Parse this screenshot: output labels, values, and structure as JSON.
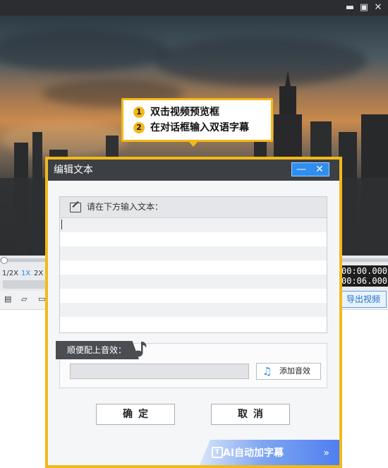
{
  "window": {
    "controls": {
      "minimize": "▬",
      "maximize": "▣",
      "close": "✕"
    }
  },
  "tooltip": {
    "steps": [
      {
        "num": "1",
        "text": "双击视频预览框"
      },
      {
        "num": "2",
        "text": "在对话框输入双语字幕"
      }
    ]
  },
  "player": {
    "speeds": [
      "1/2X",
      "1X",
      "2X"
    ],
    "active_speed": "1X",
    "time_current": "00:00.000",
    "time_total": "00:06.000",
    "export_label": "导出视频"
  },
  "dialog": {
    "title": "编辑文本",
    "minimize": "—",
    "close": "✕",
    "text_prompt": "请在下方输入文本：",
    "text_value": "",
    "sound_title": "顺便配上音效：",
    "sound_value": "",
    "add_sound_label": "添加音效",
    "ok_label": "确定",
    "cancel_label": "取消",
    "ai_label": "AI自动加字幕",
    "ai_chevron": "»"
  },
  "colors": {
    "highlight": "#f2b91a",
    "accent_blue": "#2f8ef0",
    "dialog_header": "#3c3f44"
  }
}
